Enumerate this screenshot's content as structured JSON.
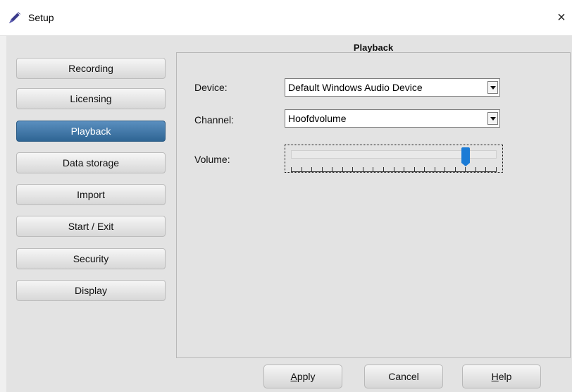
{
  "window": {
    "title": "Setup",
    "close_glyph": "×",
    "icon": "app-quill-icon"
  },
  "sidebar": {
    "items": [
      {
        "label": "Recording",
        "active": false
      },
      {
        "label": "Licensing",
        "active": false
      },
      {
        "label": "Playback",
        "active": true
      },
      {
        "label": "Data storage",
        "active": false
      },
      {
        "label": "Import",
        "active": false
      },
      {
        "label": "Start / Exit",
        "active": false
      },
      {
        "label": "Security",
        "active": false
      },
      {
        "label": "Display",
        "active": false
      }
    ]
  },
  "panel": {
    "title": "Playback",
    "device": {
      "label": "Device:",
      "value": "Default Windows Audio Device"
    },
    "channel": {
      "label": "Channel:",
      "value": "Hoofdvolume"
    },
    "volume": {
      "label": "Volume:",
      "level": 0.85,
      "tick_count": 21
    }
  },
  "buttons": {
    "apply": {
      "mnemonic": "A",
      "rest": "pply"
    },
    "cancel": {
      "label": "Cancel"
    },
    "help": {
      "mnemonic": "H",
      "rest": "elp"
    }
  },
  "colors": {
    "active_item": "#2f6594",
    "slider_thumb": "#1a7bd6"
  }
}
